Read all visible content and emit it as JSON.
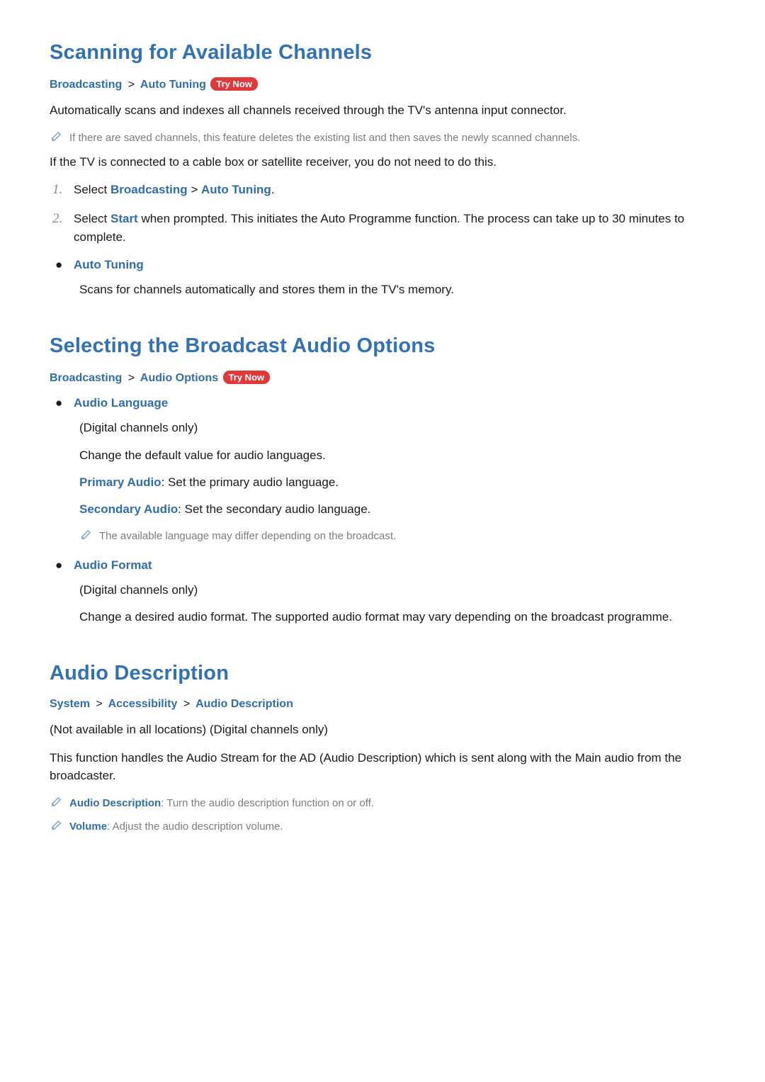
{
  "section1": {
    "title": "Scanning for Available Channels",
    "bc1": "Broadcasting",
    "sep": ">",
    "bc2": "Auto Tuning",
    "trynow": "Try Now",
    "intro": "Automatically scans and indexes all channels received through the TV's antenna input connector.",
    "note1": "If there are saved channels, this feature deletes the existing list and then saves the newly scanned channels.",
    "para2": "If the TV is connected to a cable box or satellite receiver, you do not need to do this.",
    "step1_num": "1.",
    "step1_pre": "Select ",
    "step1_hl1": "Broadcasting",
    "step1_mid": " > ",
    "step1_hl2": "Auto Tuning",
    "step1_post": ".",
    "step2_num": "2.",
    "step2_pre": "Select ",
    "step2_hl": "Start",
    "step2_post": " when prompted. This initiates the Auto Programme function. The process can take up to 30 minutes to complete.",
    "bullet1_title": "Auto Tuning",
    "bullet1_body": "Scans for channels automatically and stores them in the TV's memory."
  },
  "section2": {
    "title": "Selecting the Broadcast Audio Options",
    "bc1": "Broadcasting",
    "sep": ">",
    "bc2": "Audio Options",
    "trynow": "Try Now",
    "b1_title": "Audio Language",
    "b1_p1": "(Digital channels only)",
    "b1_p2": "Change the default value for audio languages.",
    "b1_p3_hl": "Primary Audio",
    "b1_p3_rest": ": Set the primary audio language.",
    "b1_p4_hl": "Secondary Audio",
    "b1_p4_rest": ": Set the secondary audio language.",
    "b1_note": "The available language may differ depending on the broadcast.",
    "b2_title": "Audio Format",
    "b2_p1": "(Digital channels only)",
    "b2_p2": "Change a desired audio format. The supported audio format may vary depending on the broadcast programme."
  },
  "section3": {
    "title": "Audio Description",
    "bc1": "System",
    "sep": ">",
    "bc2": "Accessibility",
    "bc3": "Audio Description",
    "p1": "(Not available in all locations) (Digital channels only)",
    "p2": "This function handles the Audio Stream for the AD (Audio Description) which is sent along with the Main audio from the broadcaster.",
    "n1_hl": "Audio Description",
    "n1_rest": ": Turn the audio description function on or off.",
    "n2_hl": "Volume",
    "n2_rest": ": Adjust the audio description volume."
  },
  "glyph": {
    "dot": "●"
  }
}
